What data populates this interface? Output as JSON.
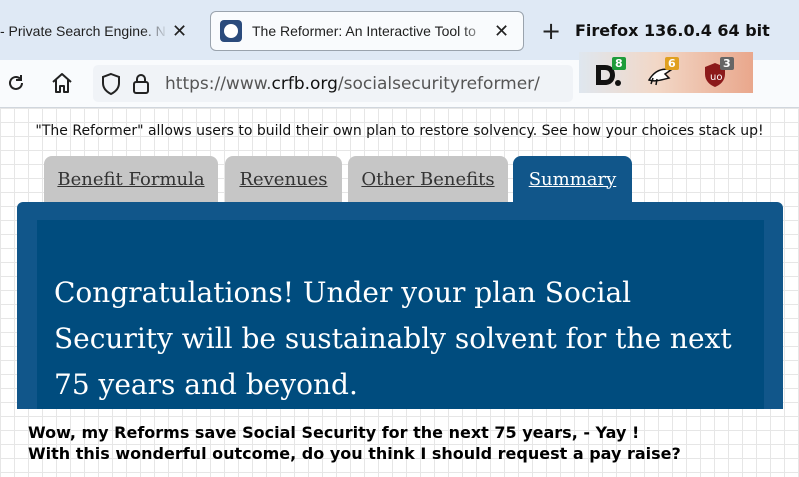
{
  "browser": {
    "tabs": [
      {
        "title": "- Private Search Engine. N",
        "active": false
      },
      {
        "title": "The Reformer: An Interactive Tool to",
        "active": true
      }
    ],
    "version_label": "Firefox 136.0.4 64 bit",
    "url_prefix": "https://www.",
    "url_host": "crfb.org",
    "url_path": "/socialsecurityreformer/",
    "extensions": [
      {
        "name": "duckduckgo-extension-icon",
        "badge": "8",
        "badge_color": "#1e9c3a"
      },
      {
        "name": "bird-extension-icon",
        "badge": "6",
        "badge_color": "#e0a020"
      },
      {
        "name": "ublock-extension-icon",
        "badge": "3",
        "badge_color": "#666666"
      }
    ]
  },
  "page": {
    "tagline": "\"The Reformer\" allows users to build their own plan to restore solvency. See how your choices stack up!",
    "tabs": [
      {
        "label": "Benefit Formula",
        "active": false
      },
      {
        "label": "Revenues",
        "active": false
      },
      {
        "label": "Other Benefits",
        "active": false
      },
      {
        "label": "Summary",
        "active": true
      }
    ],
    "congrats": "Congratulations! Under your plan Social Security will be sustainably solvent for the next 75 years and beyond."
  },
  "caption": {
    "line1": "Wow, my Reforms save Social Security for the next 75 years, - Yay !",
    "line2": "With this wonderful outcome, do you think I should request a pay raise?"
  },
  "colors": {
    "panel": "#11568a",
    "panel_inner": "#004c7e",
    "inactive_tab": "#c6c6c6"
  }
}
